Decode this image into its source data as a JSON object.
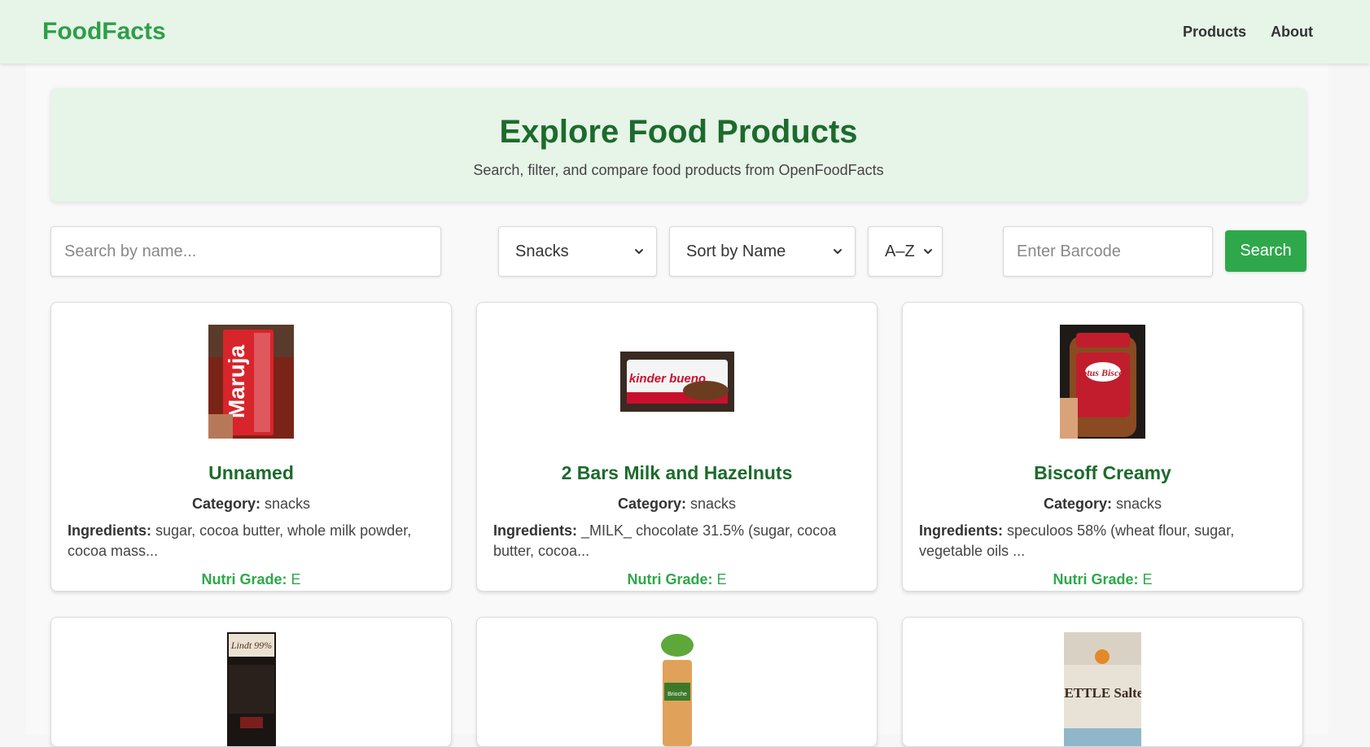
{
  "navbar": {
    "brand": "FoodFacts",
    "links": [
      "Products",
      "About"
    ]
  },
  "hero": {
    "title": "Explore Food Products",
    "subtitle": "Search, filter, and compare food products from OpenFoodFacts"
  },
  "controls": {
    "search_placeholder": "Search by name...",
    "category_value": "Snacks",
    "sort_value": "Sort by Name",
    "order_value": "A–Z",
    "barcode_placeholder": "Enter Barcode",
    "search_label": "Search"
  },
  "labels": {
    "category": "Category:",
    "ingredients": "Ingredients:",
    "nutri": "Nutri Grade:"
  },
  "products": [
    {
      "name": "Unnamed",
      "category": "snacks",
      "ingredients": "sugar, cocoa butter, whole milk powder, cocoa mass...",
      "nutri": "E",
      "image_text": "Maruja"
    },
    {
      "name": "2 Bars Milk and Hazelnuts",
      "category": "snacks",
      "ingredients": "_MILK_ chocolate 31.5% (sugar, cocoa butter, cocoa...",
      "nutri": "E",
      "image_text": "kinder bueno"
    },
    {
      "name": "Biscoff Creamy",
      "category": "snacks",
      "ingredients": "speculoos 58% (wheat flour, sugar, vegetable oils ...",
      "nutri": "E",
      "image_text": "Lotus Biscoff"
    },
    {
      "image_text": "Lindt 99%"
    },
    {
      "image_text": "Brioche"
    },
    {
      "image_text": "KETTLE Salted"
    }
  ],
  "colors": {
    "brand_green": "#2e9e48",
    "title_green": "#1c6b2c",
    "nav_bg": "#e7f4e8",
    "button_green": "#2ea84a"
  }
}
